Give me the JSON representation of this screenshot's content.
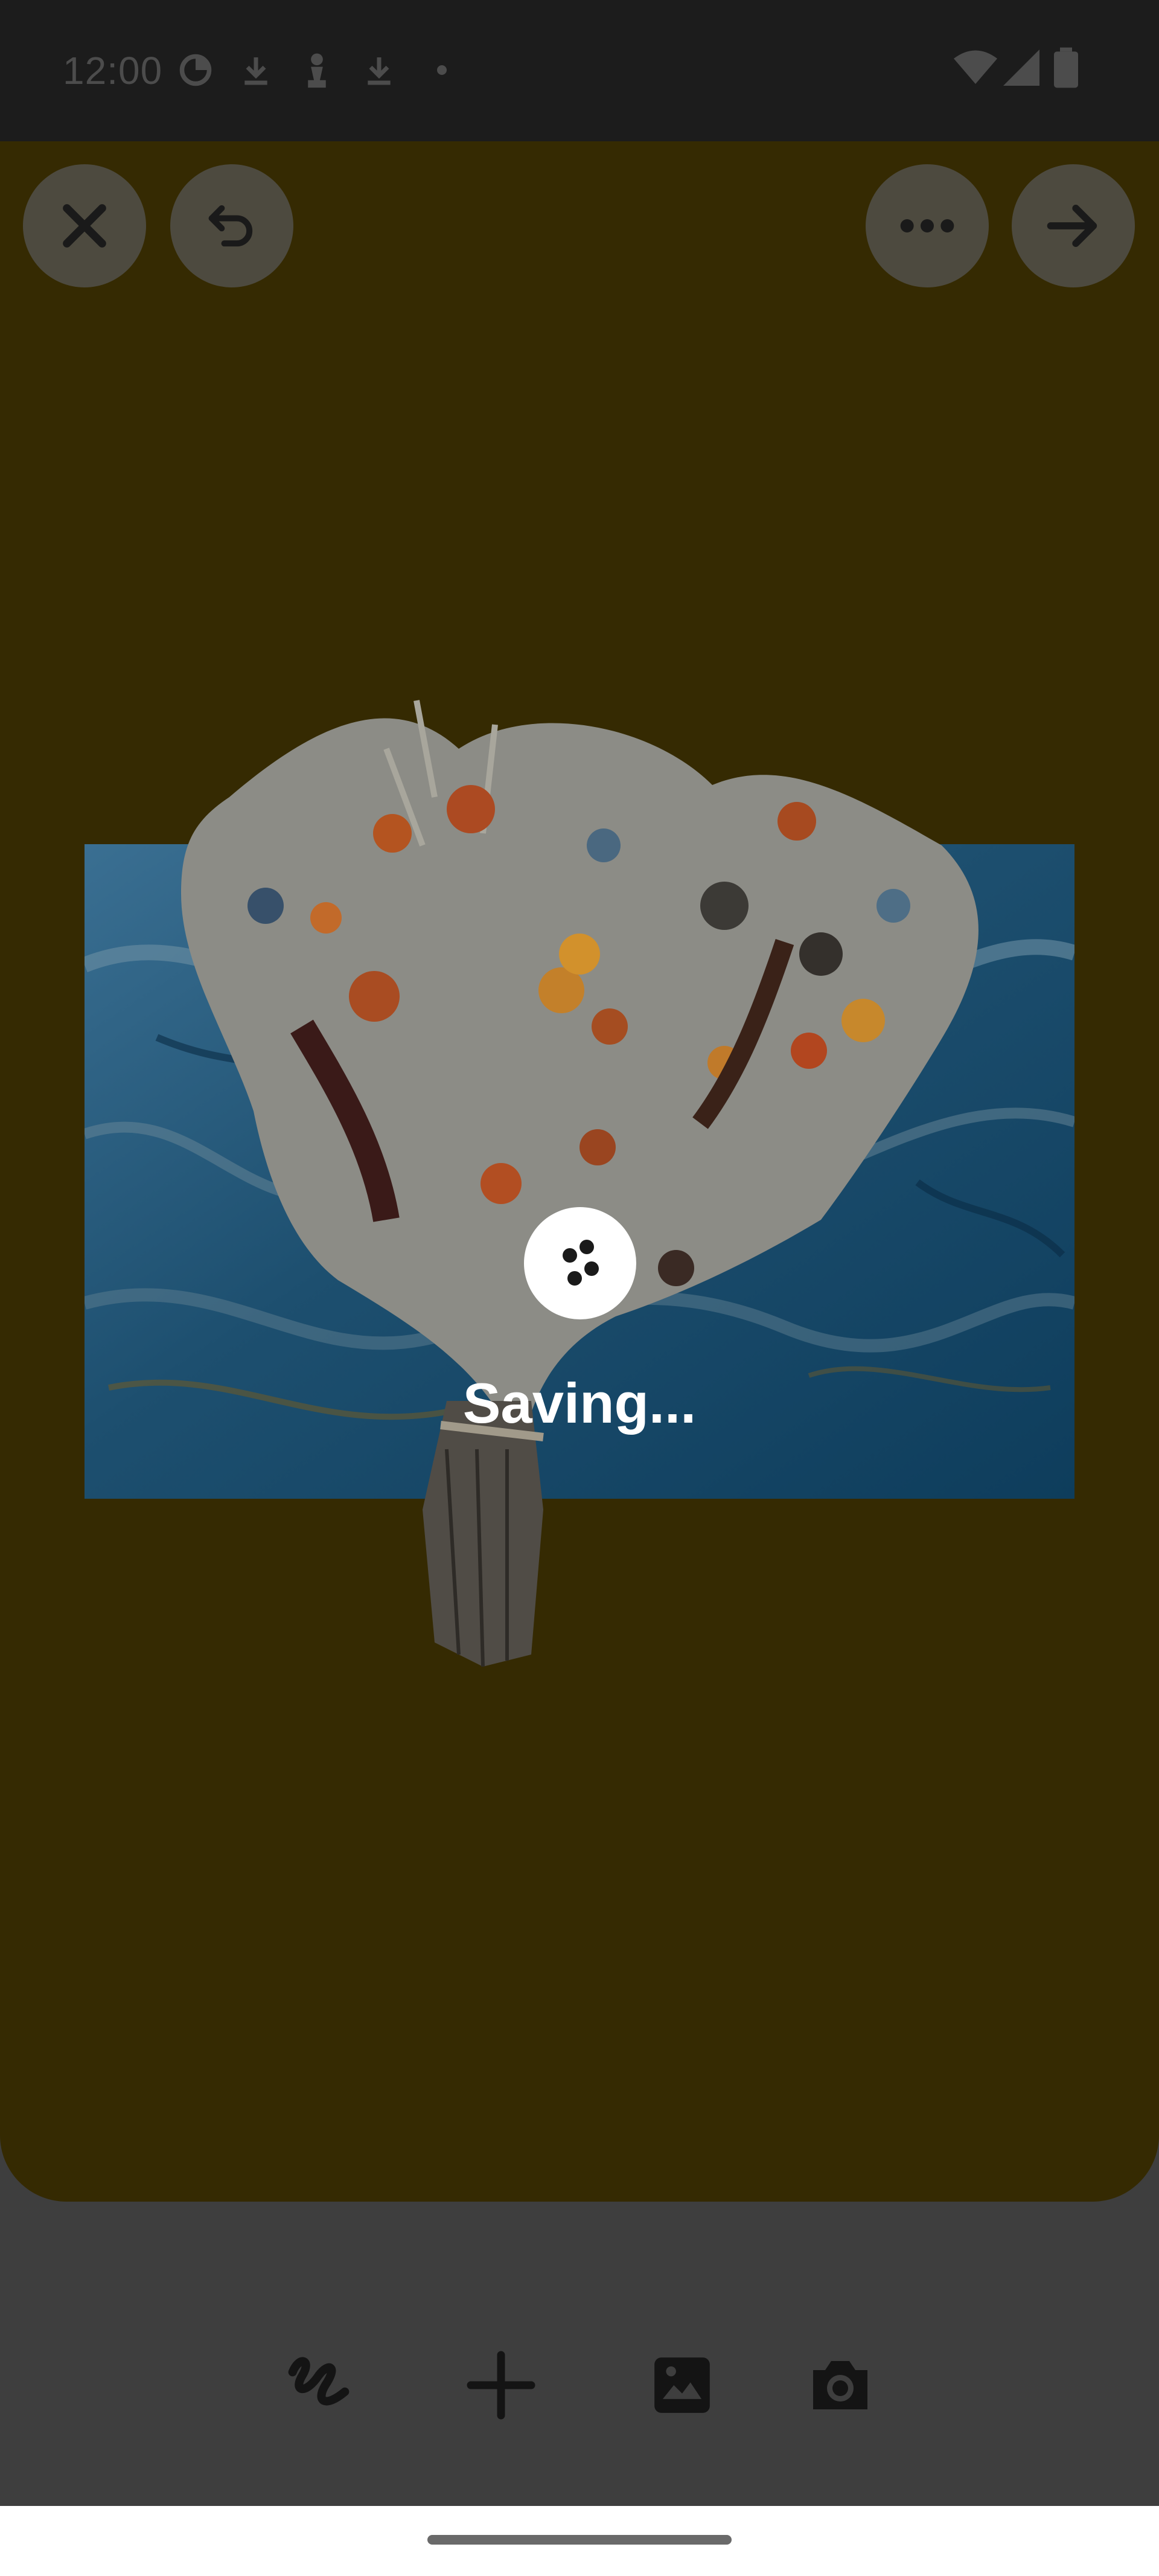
{
  "status_bar": {
    "time": "12:00",
    "left_icons": [
      "sync-icon",
      "download-icon",
      "chess-pawn-icon",
      "download-icon",
      "dot-icon"
    ],
    "right_icons": [
      "wifi-icon",
      "signal-icon",
      "battery-icon"
    ]
  },
  "top_toolbar": {
    "close": "close-icon",
    "undo": "undo-icon",
    "more": "more-horizontal-icon",
    "next": "arrow-right-icon"
  },
  "overlay": {
    "saving_text": "Saving..."
  },
  "bottom_toolbar": {
    "items": [
      "scribble-icon",
      "plus-icon",
      "image-icon",
      "camera-icon"
    ]
  },
  "colors": {
    "canvas_background": "#352a02",
    "status_bar_background": "#1c1c1c",
    "toolbar_background": "#3e3e3e",
    "spinner_background": "#ffffff"
  }
}
